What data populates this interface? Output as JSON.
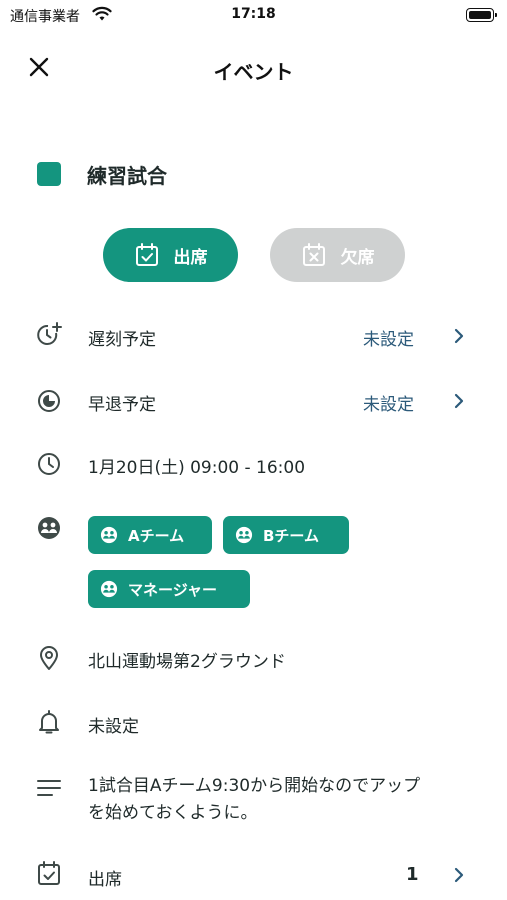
{
  "status_bar": {
    "carrier": "通信事業者",
    "time": "17:18"
  },
  "nav": {
    "title": "イベント"
  },
  "event": {
    "name": "練習試合",
    "color": "#14957f"
  },
  "attendance": {
    "present_label": "出席",
    "absent_label": "欠席"
  },
  "late": {
    "label": "遅刻予定",
    "value": "未設定"
  },
  "early_leave": {
    "label": "早退予定",
    "value": "未設定"
  },
  "datetime": {
    "text": "1月20日(土) 09:00 - 16:00"
  },
  "teams": [
    "Aチーム",
    "Bチーム",
    "マネージャー"
  ],
  "location": {
    "text": "北山運動場第2グラウンド"
  },
  "reminder": {
    "text": "未設定"
  },
  "note": {
    "line1": "1試合目Aチーム9:30から開始なのでアップ",
    "line2": "を始めておくように。"
  },
  "attendees": {
    "label": "出席",
    "count": "1"
  },
  "colors": {
    "accent": "#14957f",
    "value_text": "#2c5a7a",
    "disabled": "#cfd1d1"
  }
}
